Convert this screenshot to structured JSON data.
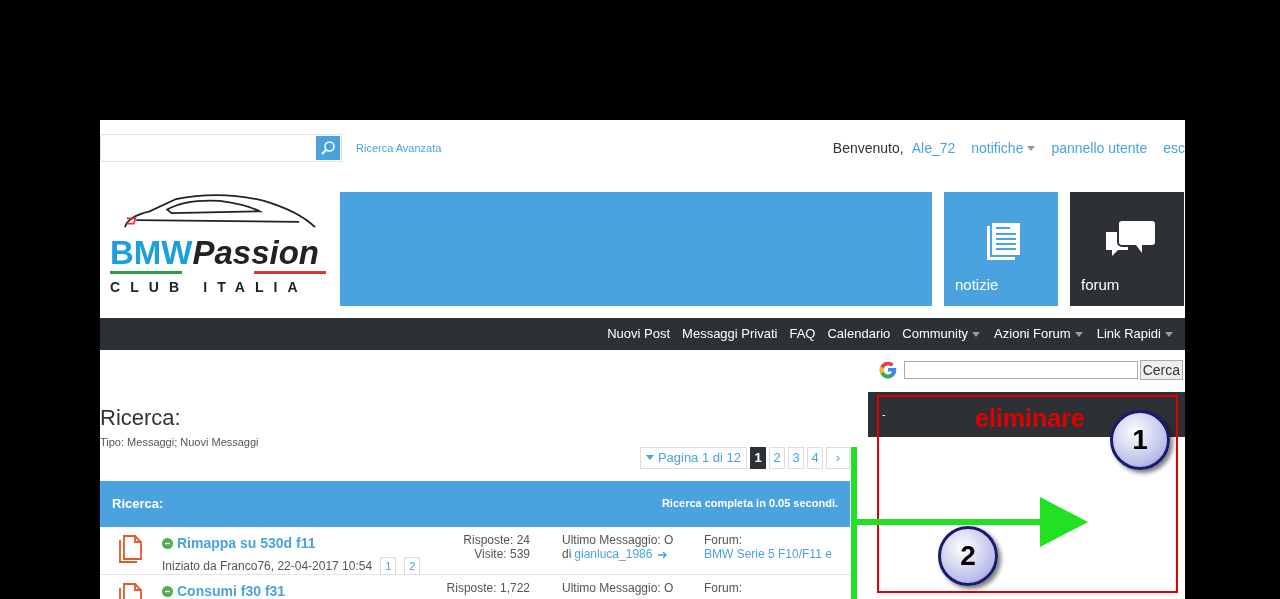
{
  "top_bar": {
    "advanced_search": "Ricerca Avanzata",
    "welcome": "Benvenuto,",
    "username": "Ale_72",
    "links": [
      {
        "label": "notifiche",
        "dropdown": true
      },
      {
        "label": "pannello utente",
        "dropdown": false
      },
      {
        "label": "esc",
        "dropdown": false
      }
    ]
  },
  "logo": {
    "brand_blue": "BMW",
    "brand_black": "Passion",
    "subtitle": "CLUB ITALIA"
  },
  "tiles": [
    {
      "kind": "news",
      "label": "notizie"
    },
    {
      "kind": "forum",
      "label": "forum"
    }
  ],
  "nav": [
    {
      "label": "Nuovi Post",
      "dropdown": false
    },
    {
      "label": "Messaggi Privati",
      "dropdown": false
    },
    {
      "label": "FAQ",
      "dropdown": false
    },
    {
      "label": "Calendario",
      "dropdown": false
    },
    {
      "label": "Community",
      "dropdown": true
    },
    {
      "label": "Azioni Forum",
      "dropdown": true
    },
    {
      "label": "Link Rapidi",
      "dropdown": true
    }
  ],
  "google_search": {
    "button": "Cerca"
  },
  "page": {
    "title": "Ricerca:",
    "subtitle": "Tipo: Messaggi; Nuovi Messaggi"
  },
  "pagination": {
    "summary": "Pagina 1 di 12",
    "pages": [
      {
        "label": "1",
        "selected": true
      },
      {
        "label": "2",
        "selected": false
      },
      {
        "label": "3",
        "selected": false
      },
      {
        "label": "4",
        "selected": false
      }
    ],
    "next": "›"
  },
  "results_header": {
    "title": "Ricerca:",
    "info": "Ricerca completa in 0.05 secondi."
  },
  "results": [
    {
      "title": "Rimappa su 530d f11",
      "started": "Iniziato da Franco76, 22-04-2017 10:54",
      "pages": [
        "1",
        "2"
      ],
      "replies": "Risposte: 24",
      "views": "Visite: 539",
      "last_label": "Ultimo Messaggio: O",
      "last_by": "di",
      "last_user": "gianluca_1986",
      "forum_label": "Forum:",
      "forum": "BMW Serie 5 F10/F11 e"
    },
    {
      "title": "Consumi f30 f31",
      "replies": "Risposte: 1,722",
      "last_label": "Ultimo Messaggio: O",
      "forum_label": "Forum:"
    }
  ],
  "sidebar": {
    "header": "-"
  },
  "annotations": {
    "label": "eliminare",
    "markers": [
      "1",
      "2"
    ]
  }
}
